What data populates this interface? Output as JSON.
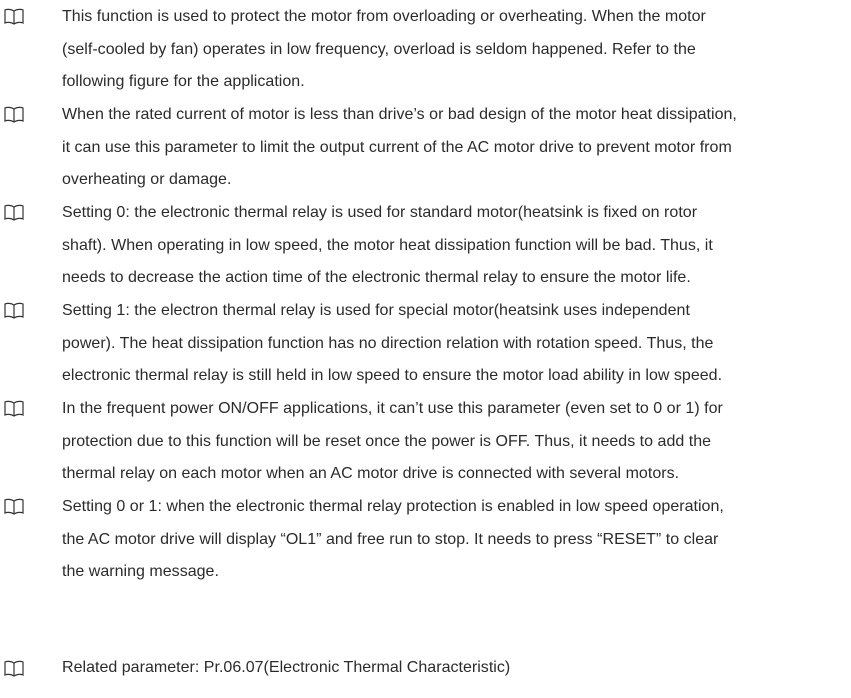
{
  "bullet_icon": "open-book-icon",
  "items": [
    {
      "lines": [
        "This function is used to protect the motor from overloading or overheating. When the motor",
        "(self-cooled by fan) operates in low frequency, overload is seldom happened. Refer to the",
        "following figure for the application."
      ]
    },
    {
      "lines": [
        "When the rated current of motor is less than drive’s or bad design of the motor heat dissipation,",
        "it can use this parameter to limit the output current of the AC motor drive to prevent motor from",
        "overheating or damage."
      ]
    },
    {
      "lines": [
        "Setting 0: the electronic thermal relay is used for standard motor(heatsink is fixed on rotor",
        "shaft). When operating in low speed, the motor heat dissipation function will be bad. Thus, it",
        "needs to decrease the action time of the electronic thermal relay to ensure the motor life."
      ]
    },
    {
      "lines": [
        "Setting 1: the electron thermal relay is used for special motor(heatsink uses independent",
        "power). The heat dissipation function has no direction relation with rotation speed. Thus, the",
        "electronic thermal relay is still held in low speed to ensure the motor load ability in low speed."
      ]
    },
    {
      "lines": [
        "In the frequent power ON/OFF applications, it can’t use this parameter (even set to 0 or 1) for",
        "protection due to this function will be reset once the power is OFF. Thus, it needs to add the",
        "thermal relay on each motor when an AC motor drive is connected with several motors."
      ]
    },
    {
      "lines": [
        "Setting 0 or 1: when the electronic thermal relay protection is enabled in low speed operation,",
        "the AC motor drive will display “OL1” and free run to stop. It needs to press “RESET” to clear",
        "the warning message."
      ]
    },
    {
      "lines": [
        "Related parameter: Pr.06.07(Electronic Thermal Characteristic)"
      ]
    }
  ]
}
